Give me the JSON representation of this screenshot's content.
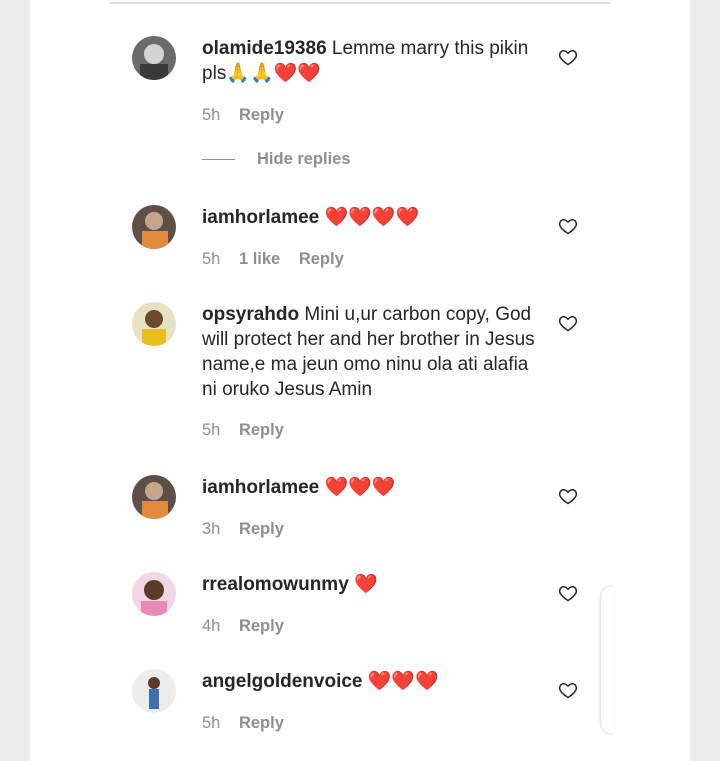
{
  "comments": [
    {
      "username": "olamide19386",
      "text": "Lemme marry this pikin pls🙏🙏❤️❤️",
      "time": "5h",
      "likes": "",
      "reply": "Reply"
    },
    {
      "username": "iamhorlamee",
      "text": "❤️❤️❤️❤️",
      "time": "5h",
      "likes": "1 like",
      "reply": "Reply"
    },
    {
      "username": "opsyrahdo",
      "text": "Mini u,ur carbon copy, God will protect her and her brother in Jesus name,e ma jeun omo ninu ola ati alafia ni oruko Jesus Amin",
      "time": "5h",
      "likes": "",
      "reply": "Reply"
    },
    {
      "username": "iamhorlamee",
      "text": "❤️❤️❤️",
      "time": "3h",
      "likes": "",
      "reply": "Reply"
    },
    {
      "username": "rrealomowunmy",
      "text": "❤️",
      "time": "4h",
      "likes": "",
      "reply": "Reply"
    },
    {
      "username": "angelgoldenvoice",
      "text": "❤️❤️❤️",
      "time": "5h",
      "likes": "",
      "reply": "Reply"
    }
  ],
  "hide_replies_label": "Hide replies",
  "icons": {
    "like": "heart-outline-icon"
  },
  "colors": {
    "username": "#262626",
    "meta": "#8e8e8e",
    "heart": "#e0242f"
  }
}
